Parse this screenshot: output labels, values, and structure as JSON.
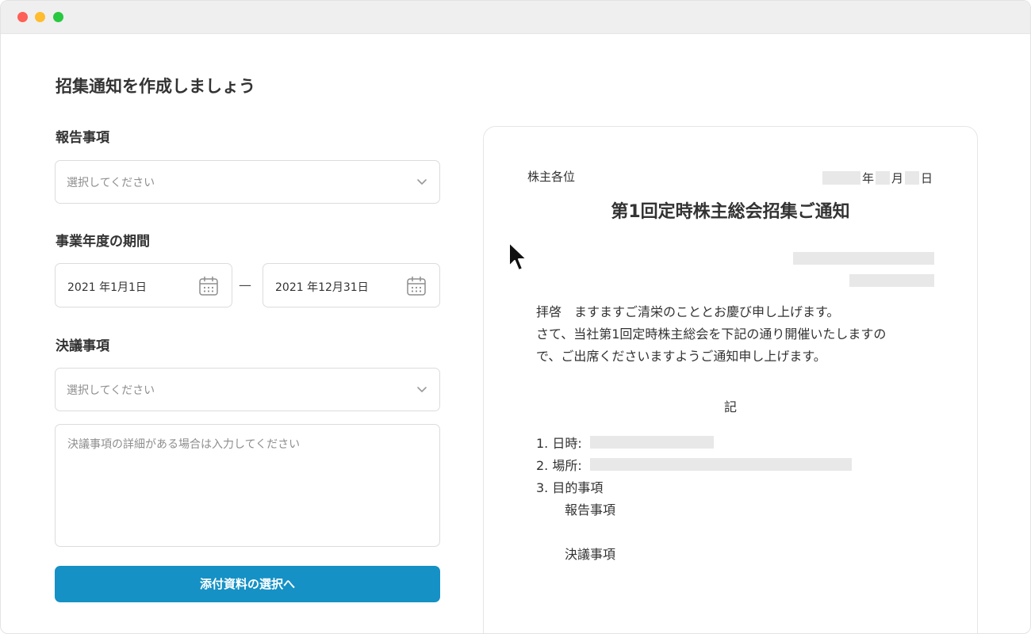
{
  "window": {
    "controls": [
      "close",
      "minimize",
      "zoom"
    ]
  },
  "form": {
    "title": "招集通知を作成しましょう",
    "report": {
      "label": "報告事項",
      "placeholder": "選択してください"
    },
    "fiscal_period": {
      "label": "事業年度の期間",
      "start": "2021 年1月1日",
      "separator": "—",
      "end": "2021 年12月31日"
    },
    "resolution": {
      "label": "決議事項",
      "placeholder": "選択してください",
      "detail_placeholder": "決議事項の詳細がある場合は入力してください"
    },
    "next_button": "添付資料の選択へ",
    "colors": {
      "primary": "#1591c5"
    }
  },
  "preview": {
    "recipient": "株主各位",
    "date_labels": {
      "year": "年",
      "month": "月",
      "day": "日"
    },
    "title": "第1回定時株主総会招集ご通知",
    "body_lines": [
      "拝啓　ますますご清栄のこととお慶び申し上げます。",
      "さて、当社第1回定時株主総会を下記の通り開催いたしますの",
      "で、ご出席くださいますようご通知申し上げます。"
    ],
    "ki": "記",
    "items": {
      "datetime": "1. 日時:",
      "place": "2. 場所:",
      "purpose": "3. 目的事項",
      "report": "報告事項",
      "resolution": "決議事項"
    }
  }
}
